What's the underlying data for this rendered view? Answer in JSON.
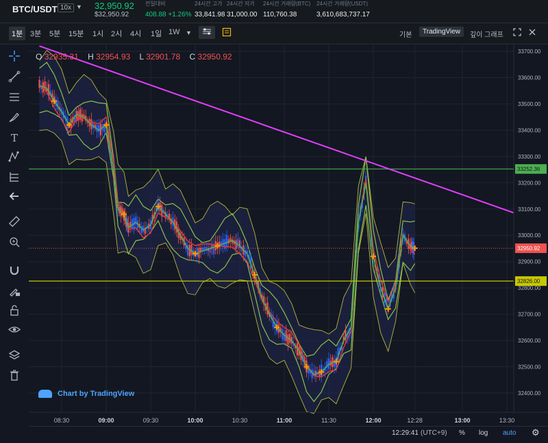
{
  "header": {
    "symbol": "BTC/USDT",
    "leverage": "10x",
    "last_price": "32,950.92",
    "last_price_usd": "$32,950.92",
    "stats": [
      {
        "label": "전일대비",
        "value": "408.88 +1.26%",
        "positive": true
      },
      {
        "label": "24시간 고가",
        "value": "33,841.98"
      },
      {
        "label": "24시간 저가",
        "value": "31,000.00"
      },
      {
        "label": "24시간 거래량(BTC)",
        "value": "110,760.38"
      },
      {
        "label": "24시간 거래량(USDT)",
        "value": "3,610,683,737.17"
      }
    ]
  },
  "toolbar": {
    "timeframes": [
      "1분",
      "3분",
      "5분",
      "15분",
      "1시",
      "2시",
      "4시",
      "1일",
      "1W"
    ],
    "active_timeframe": "1분",
    "dropdown_caret": "▼",
    "views": [
      "기본",
      "TradingView",
      "깊이 그래프"
    ],
    "active_view": "TradingView"
  },
  "ohlc": {
    "o_label": "O",
    "o": "32935.31",
    "h_label": "H",
    "h": "32954.93",
    "l_label": "L",
    "l": "32901.78",
    "c_label": "C",
    "c": "32950.92"
  },
  "branding": "Chart by TradingView",
  "bottom": {
    "time": "12:29:41",
    "tz": "(UTC+9)",
    "pct": "%",
    "log": "log",
    "auto": "auto"
  },
  "colors": {
    "up": "#26a69a",
    "down": "#ef5350",
    "trendline": "#e040fb",
    "resistance": "#4caf50",
    "support": "#c8c800",
    "bb": "#b5b83a",
    "ma_fast": "#4caf50",
    "ma_slow": "#e53935"
  },
  "icons": [
    "crosshair-icon",
    "trendline-icon",
    "fib-icon",
    "brush-icon",
    "text-icon",
    "pattern-icon",
    "forecast-icon",
    "back-arrow-icon",
    "ruler-icon",
    "zoom-icon",
    "magnet-icon",
    "lock-draw-icon",
    "lock-icon",
    "eye-icon",
    "layers-icon",
    "trash-icon"
  ],
  "chart_data": {
    "type": "candlestick",
    "ylim": [
      32370,
      33720
    ],
    "y_ticks": [
      "33700.00",
      "33600.00",
      "33500.00",
      "33400.00",
      "33300.00",
      "33200.00",
      "33100.00",
      "33000.00",
      "32900.00",
      "32800.00",
      "32700.00",
      "32600.00",
      "32500.00",
      "32400.00"
    ],
    "x_ticks": [
      "08:30",
      "09:00",
      "09:30",
      "10:00",
      "10:30",
      "11:00",
      "11:30",
      "12:00",
      "12:28",
      "13:00",
      "13:30"
    ],
    "price_labels": [
      {
        "value": 33252.36,
        "text": "33252.36",
        "role": "resistance line"
      },
      {
        "value": 32950.92,
        "text": "32950.92",
        "role": "last price"
      },
      {
        "value": 32826.0,
        "text": "32826.00",
        "role": "support line"
      }
    ],
    "trendline": {
      "from": [
        "08:15",
        33720
      ],
      "to": [
        "13:35",
        33085
      ]
    },
    "close_path": [
      [
        "08:15",
        33570
      ],
      [
        "08:20",
        33560
      ],
      [
        "08:25",
        33510
      ],
      [
        "08:30",
        33470
      ],
      [
        "08:35",
        33420
      ],
      [
        "08:40",
        33460
      ],
      [
        "08:45",
        33450
      ],
      [
        "08:50",
        33420
      ],
      [
        "08:55",
        33400
      ],
      [
        "09:00",
        33420
      ],
      [
        "09:05",
        33250
      ],
      [
        "09:08",
        33100
      ],
      [
        "09:12",
        33080
      ],
      [
        "09:15",
        33030
      ],
      [
        "09:20",
        33050
      ],
      [
        "09:25",
        33020
      ],
      [
        "09:30",
        33040
      ],
      [
        "09:35",
        33110
      ],
      [
        "09:40",
        33080
      ],
      [
        "09:45",
        33050
      ],
      [
        "09:50",
        33000
      ],
      [
        "09:55",
        32950
      ],
      [
        "10:00",
        32930
      ],
      [
        "10:05",
        32940
      ],
      [
        "10:10",
        32950
      ],
      [
        "10:15",
        32960
      ],
      [
        "10:20",
        32970
      ],
      [
        "10:25",
        32980
      ],
      [
        "10:30",
        32960
      ],
      [
        "10:35",
        32930
      ],
      [
        "10:40",
        32850
      ],
      [
        "10:45",
        32760
      ],
      [
        "10:50",
        32700
      ],
      [
        "10:55",
        32650
      ],
      [
        "11:00",
        32620
      ],
      [
        "11:05",
        32600
      ],
      [
        "11:10",
        32560
      ],
      [
        "11:15",
        32500
      ],
      [
        "11:20",
        32470
      ],
      [
        "11:25",
        32480
      ],
      [
        "11:30",
        32510
      ],
      [
        "11:35",
        32520
      ],
      [
        "11:40",
        32600
      ],
      [
        "11:45",
        32650
      ],
      [
        "11:50",
        33050
      ],
      [
        "11:55",
        33200
      ],
      [
        "12:00",
        32920
      ],
      [
        "12:05",
        32800
      ],
      [
        "12:10",
        32720
      ],
      [
        "12:15",
        32800
      ],
      [
        "12:20",
        33000
      ],
      [
        "12:25",
        32960
      ],
      [
        "12:28",
        32951
      ]
    ]
  }
}
